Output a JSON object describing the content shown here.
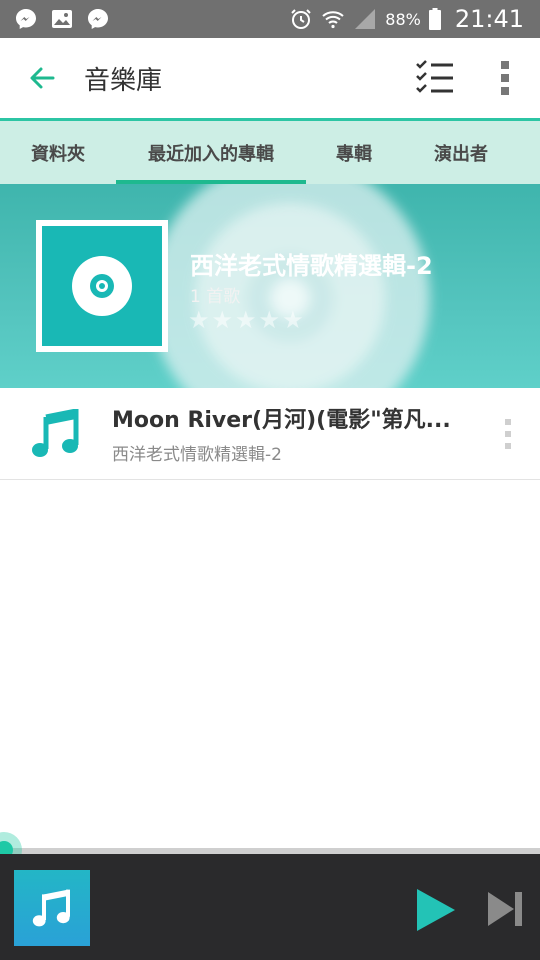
{
  "status_bar": {
    "battery": "88%",
    "time": "21:41",
    "icons": [
      "messenger-icon",
      "gallery-icon",
      "messenger-icon",
      "alarm-icon",
      "wifi-icon",
      "signal-icon",
      "battery-icon"
    ]
  },
  "app_bar": {
    "title": "音樂庫",
    "back_icon": "back-arrow-icon",
    "select_icon": "checklist-icon",
    "overflow_icon": "overflow-menu-icon"
  },
  "tabs": [
    {
      "label": "資料夾",
      "active": false
    },
    {
      "label": "最近加入的專輯",
      "active": true
    },
    {
      "label": "專輯",
      "active": false
    },
    {
      "label": "演出者",
      "active": false
    }
  ],
  "album": {
    "title": "西洋老式情歌精選輯-2",
    "song_count": "1 首歌",
    "rating_stars": 5,
    "rating": 0
  },
  "songs": [
    {
      "title": "Moon River(月河)(電影\"第凡...",
      "album": "西洋老式情歌精選輯-2"
    }
  ],
  "player": {
    "progress_percent": 0,
    "play_icon": "play-icon",
    "next_icon": "skip-next-icon"
  },
  "colors": {
    "accent": "#1eb98f",
    "status_bar": "#707070",
    "tab_bg": "#cdeee5",
    "album_art": "#19b8b5",
    "player_bg": "#2a2a2c"
  }
}
